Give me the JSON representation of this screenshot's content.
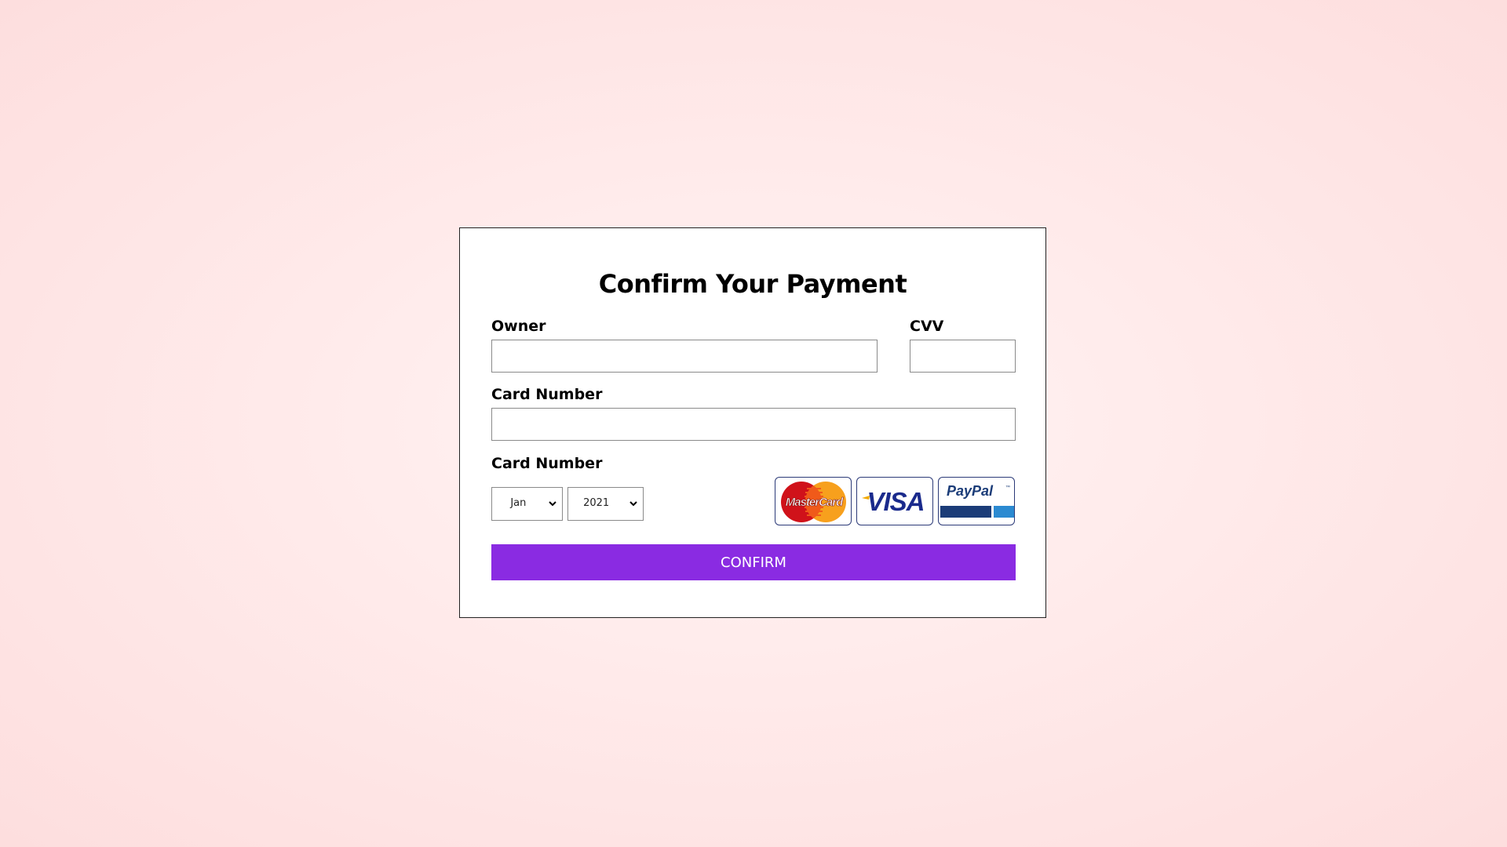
{
  "form": {
    "title": "Confirm Your Payment",
    "owner_label": "Owner",
    "owner_value": "",
    "cvv_label": "CVV",
    "cvv_value": "",
    "card_number_label": "Card Number",
    "card_number_value": "",
    "expiry_label": "Card Number",
    "month_selected": "Jan",
    "year_selected": "2021",
    "confirm_label": "CONFIRM"
  },
  "payment_logos": {
    "mastercard_text": "MasterCard",
    "visa_text": "VISA",
    "paypal_text": "PayPal"
  },
  "colors": {
    "accent": "#8a2be2",
    "mastercard_red": "#d0121a",
    "mastercard_orange": "#f7a01d",
    "visa_blue": "#1a2a8c",
    "visa_gold": "#f2a900",
    "paypal_dark": "#1b3c78",
    "paypal_light": "#2b8ad1"
  },
  "icons": {
    "month_dropdown": "chevron-down-icon",
    "year_dropdown": "chevron-down-icon"
  }
}
